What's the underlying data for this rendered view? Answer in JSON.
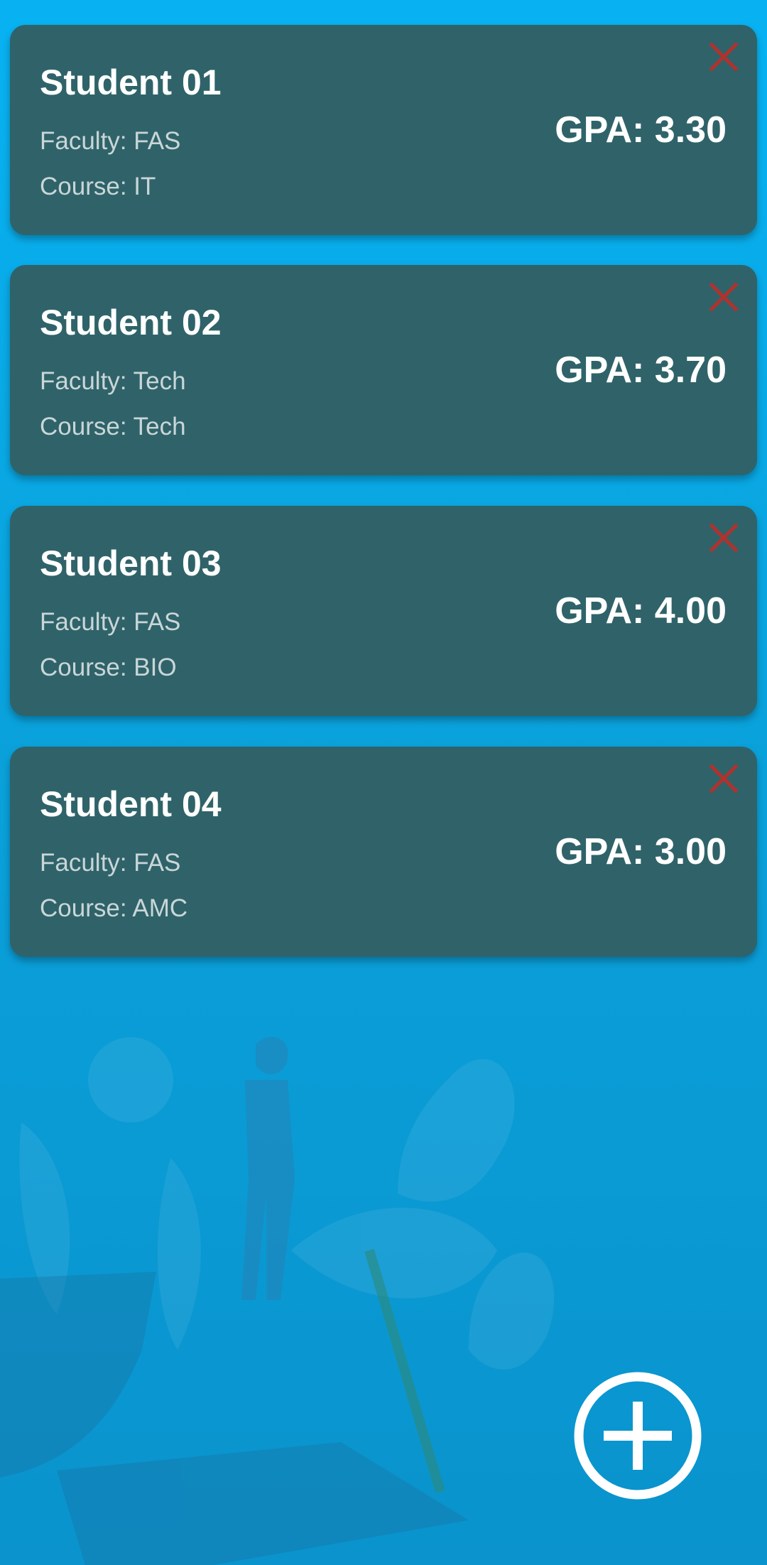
{
  "colors": {
    "background": "#09a6e3",
    "card": "#2f6369",
    "delete_icon": "#b0322e",
    "text_primary": "#ffffff",
    "text_secondary": "#c9d6d8"
  },
  "students": [
    {
      "name": "Student 01",
      "faculty": "Faculty: FAS",
      "course": "Course: IT",
      "gpa": "GPA: 3.30",
      "delete_icon": "close-icon"
    },
    {
      "name": "Student 02",
      "faculty": "Faculty: Tech",
      "course": "Course: Tech",
      "gpa": "GPA: 3.70",
      "delete_icon": "close-icon"
    },
    {
      "name": "Student 03",
      "faculty": "Faculty: FAS",
      "course": "Course: BIO",
      "gpa": "GPA: 4.00",
      "delete_icon": "close-icon"
    },
    {
      "name": "Student 04",
      "faculty": "Faculty: FAS",
      "course": "Course: AMC",
      "gpa": "GPA: 3.00",
      "delete_icon": "close-icon"
    }
  ],
  "fab": {
    "icon": "add-circle-icon"
  }
}
